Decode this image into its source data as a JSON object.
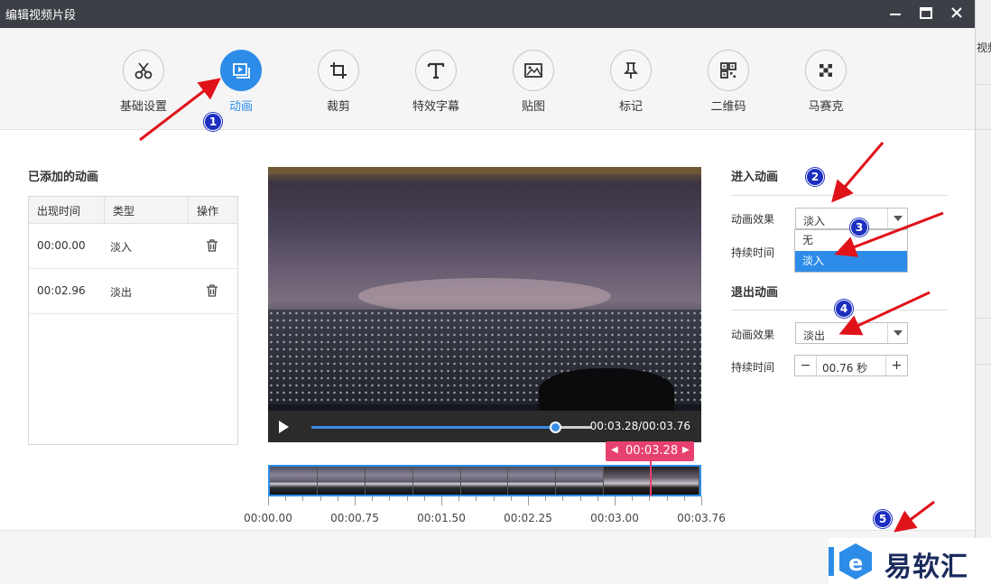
{
  "window": {
    "title": "编辑视频片段",
    "background_app_text": "视频"
  },
  "toolbar": {
    "items": [
      {
        "label": "基础设置",
        "icon": "scissors-icon",
        "active": false
      },
      {
        "label": "动画",
        "icon": "play-frame-icon",
        "active": true
      },
      {
        "label": "裁剪",
        "icon": "crop-icon",
        "active": false
      },
      {
        "label": "特效字幕",
        "icon": "text-icon",
        "active": false
      },
      {
        "label": "贴图",
        "icon": "image-icon",
        "active": false
      },
      {
        "label": "标记",
        "icon": "pin-icon",
        "active": false
      },
      {
        "label": "二维码",
        "icon": "qrcode-icon",
        "active": false
      },
      {
        "label": "马赛克",
        "icon": "mosaic-icon",
        "active": false
      }
    ]
  },
  "added_animations": {
    "title": "已添加的动画",
    "columns": [
      "出现时间",
      "类型",
      "操作"
    ],
    "rows": [
      {
        "time": "00:00.00",
        "type": "淡入"
      },
      {
        "time": "00:02.96",
        "type": "淡出"
      }
    ]
  },
  "player": {
    "time_display": "00:03.28/00:03.76",
    "progress": 0.872
  },
  "timeline": {
    "playhead_label": "00:03.28",
    "ticks": [
      "00:00.00",
      "00:00.75",
      "00:01.50",
      "00:02.25",
      "00:03.00",
      "00:03.76"
    ]
  },
  "enter_animation": {
    "title": "进入动画",
    "effect_label": "动画效果",
    "effect_value": "淡入",
    "duration_label": "持续时间",
    "dropdown_options": [
      "无",
      "淡入"
    ],
    "dropdown_selected": "淡入"
  },
  "exit_animation": {
    "title": "退出动画",
    "effect_label": "动画效果",
    "effect_value": "淡出",
    "duration_label": "持续时间",
    "duration_value": "00.76 秒"
  },
  "annotations": {
    "markers": [
      "1",
      "2",
      "3",
      "4",
      "5"
    ],
    "marker_color": "#1c2fc0",
    "arrow_color": "#e0121a"
  },
  "watermark": {
    "text": "易软汇"
  },
  "colors": {
    "accent": "#2d8ce8",
    "playhead": "#e8416f",
    "titlebar": "#3c3f45"
  }
}
